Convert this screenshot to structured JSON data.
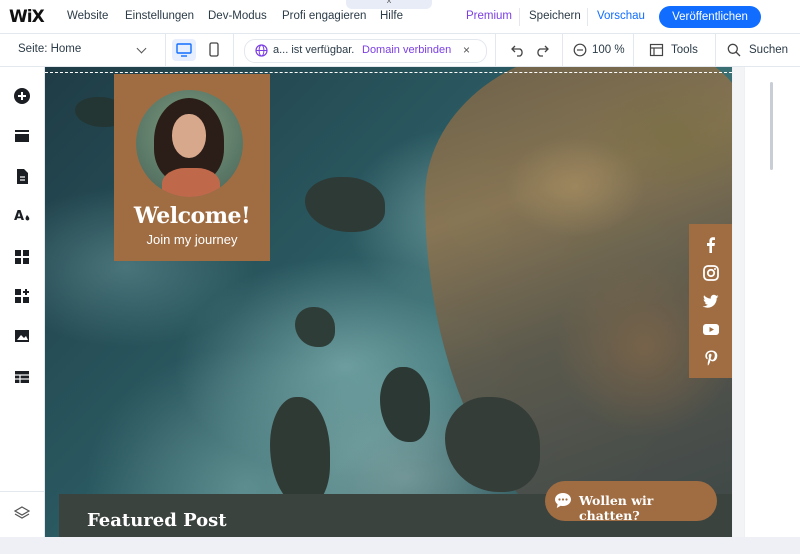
{
  "topbar": {
    "logo": "WiX",
    "menu": [
      "Website",
      "Einstellungen",
      "Dev-Modus",
      "Profi engagieren",
      "Hilfe"
    ],
    "collapse": "^",
    "premium": "Premium",
    "save": "Speichern",
    "preview": "Vorschau",
    "publish": "Veröffentlichen"
  },
  "toolbar": {
    "page": "Seite: Home",
    "domain_text": "a... ist verfügbar.",
    "domain_link": "Domain verbinden",
    "close": "×",
    "zoom": "100 %",
    "tools": "Tools",
    "search": "Suchen"
  },
  "site": {
    "welcome_title": "Welcome!",
    "welcome_sub": "Join my journey",
    "featured_title": "Featured Post",
    "chat_label": "Wollen wir chatten?"
  },
  "colors": {
    "accent": "#116dff",
    "premium": "#7b3fe4",
    "card": "#a06d43"
  },
  "icons": {
    "left": [
      "add-icon",
      "sections-icon",
      "pages-icon",
      "design-icon",
      "apps-icon",
      "add-apps-icon",
      "media-icon",
      "cms-icon",
      "layers-icon"
    ],
    "social": [
      "facebook-icon",
      "instagram-icon",
      "twitter-icon",
      "youtube-icon",
      "pinterest-icon"
    ]
  }
}
